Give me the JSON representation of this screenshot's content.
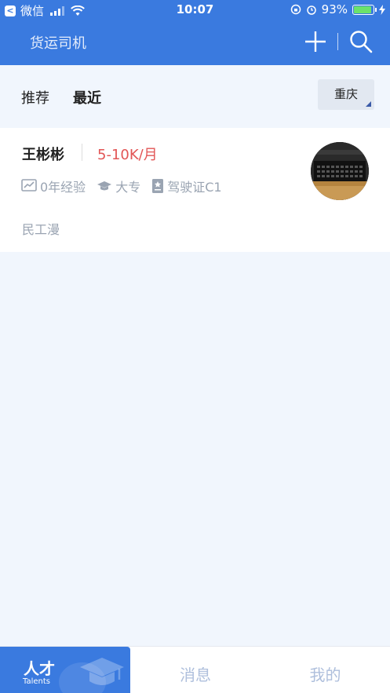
{
  "status_bar": {
    "back_app": "微信",
    "time": "10:07",
    "battery_percent": "93%",
    "battery_level": 0.93
  },
  "nav": {
    "title": "货运司机",
    "add_icon": "plus-icon",
    "search_icon": "search-icon"
  },
  "filters": {
    "tabs": [
      {
        "label": "推荐",
        "active": false
      },
      {
        "label": "最近",
        "active": true
      }
    ],
    "city": "重庆"
  },
  "candidates": [
    {
      "name": "王彬彬",
      "salary": "5-10K/月",
      "experience": "0年经验",
      "education": "大专",
      "license": "驾驶证C1",
      "company": "民工漫"
    }
  ],
  "tabbar": {
    "items": [
      {
        "label": "人才",
        "sublabel": "Talents",
        "active": true
      },
      {
        "label": "消息",
        "active": false
      },
      {
        "label": "我的",
        "active": false
      }
    ]
  },
  "colors": {
    "brand": "#3a7adf",
    "salary": "#e25555",
    "muted": "#9aa4b2"
  }
}
